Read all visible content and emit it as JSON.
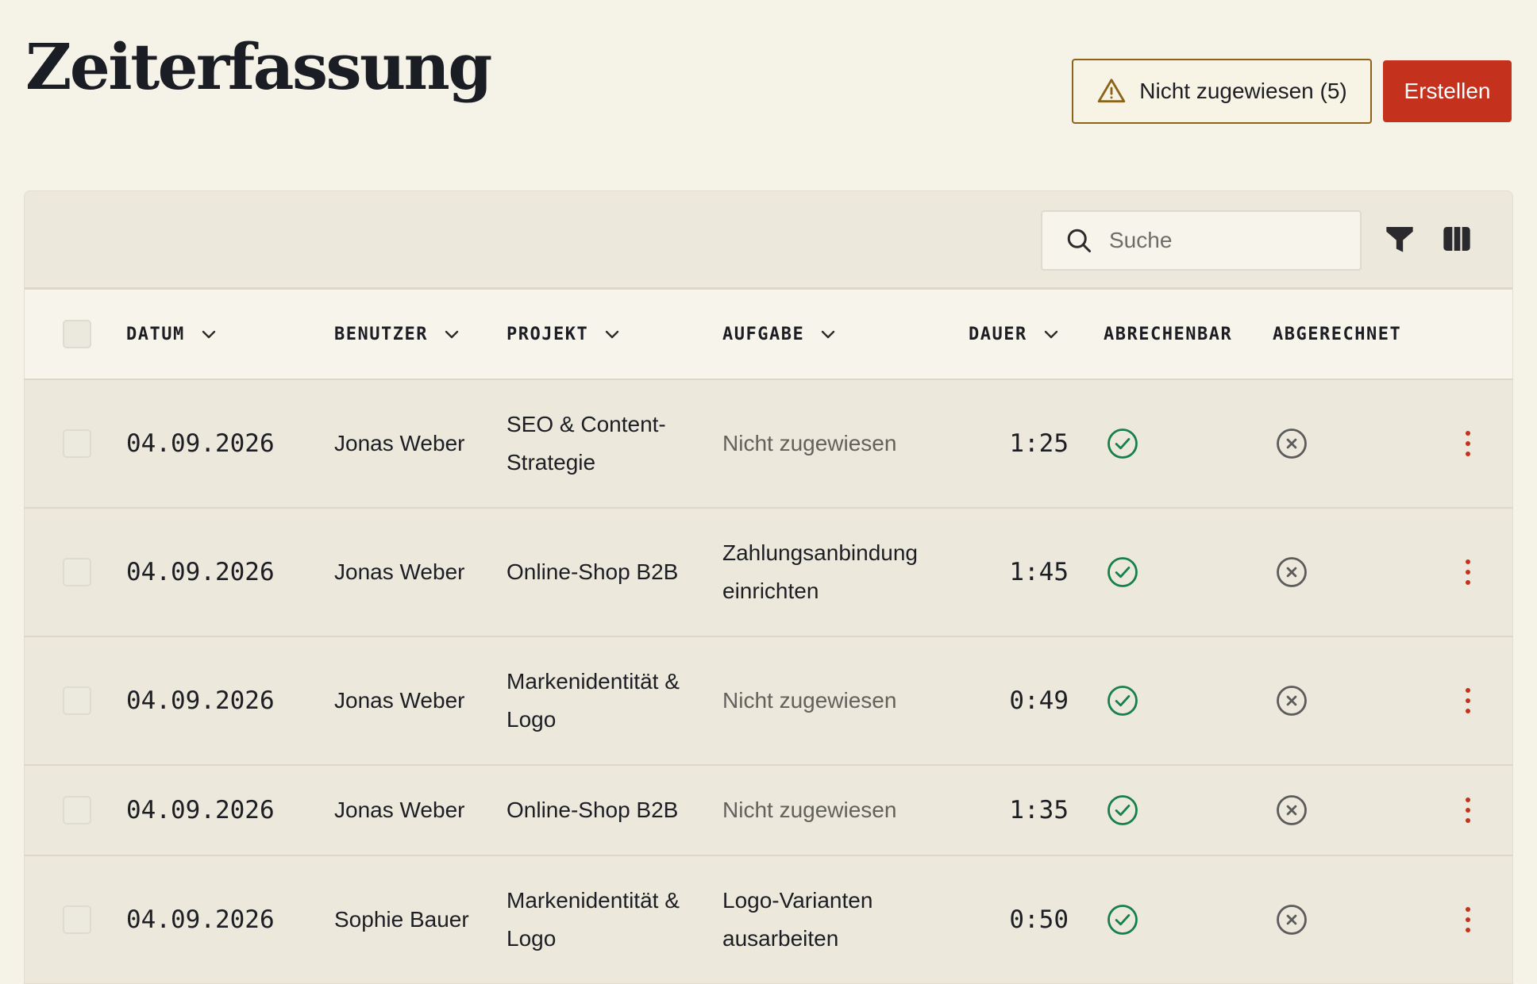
{
  "header": {
    "title": "Zeiterfassung",
    "unassigned_label": "Nicht zugewiesen (5)",
    "create_label": "Erstellen"
  },
  "toolbar": {
    "search_placeholder": "Suche",
    "search_value": ""
  },
  "columns": {
    "date": "DATUM",
    "user": "BENUTZER",
    "project": "PROJEKT",
    "task": "AUFGABE",
    "duration": "DAUER",
    "billable": "ABRECHENBAR",
    "billed": "ABGERECHNET"
  },
  "rows": [
    {
      "date": "04.09.2026",
      "user": "Jonas Weber",
      "project": "SEO & Content-Strategie",
      "task": "Nicht zugewiesen",
      "task_unassigned": true,
      "duration": "1:25",
      "billable": true,
      "billed": false
    },
    {
      "date": "04.09.2026",
      "user": "Jonas Weber",
      "project": "Online-Shop B2B",
      "task": "Zahlungsanbindung einrichten",
      "task_unassigned": false,
      "duration": "1:45",
      "billable": true,
      "billed": false
    },
    {
      "date": "04.09.2026",
      "user": "Jonas Weber",
      "project": "Markenidentität & Logo",
      "task": "Nicht zugewiesen",
      "task_unassigned": true,
      "duration": "0:49",
      "billable": true,
      "billed": false
    },
    {
      "date": "04.09.2026",
      "user": "Jonas Weber",
      "project": "Online-Shop B2B",
      "task": "Nicht zugewiesen",
      "task_unassigned": true,
      "duration": "1:35",
      "billable": true,
      "billed": false
    },
    {
      "date": "04.09.2026",
      "user": "Sophie Bauer",
      "project": "Markenidentität & Logo",
      "task": "Logo-Varianten ausarbeiten",
      "task_unassigned": false,
      "duration": "0:50",
      "billable": true,
      "billed": false
    }
  ],
  "colors": {
    "accent": "#c4311d",
    "warning": "#8c6318",
    "success": "#17804a",
    "neutral_icon": "#5b5b5b"
  },
  "icons": {
    "unassigned": "warning-triangle-icon",
    "search": "search-icon",
    "filter": "filter-icon",
    "columns": "columns-icon",
    "billable": "check-circle-icon",
    "billed": "x-circle-icon",
    "row_menu": "more-vertical-icon",
    "sort": "chevron-down-icon"
  }
}
